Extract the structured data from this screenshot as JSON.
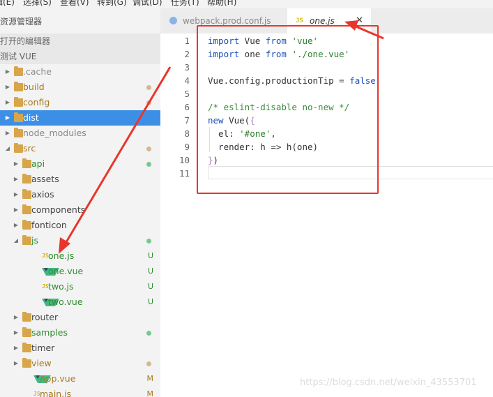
{
  "menu": [
    "辑(E)",
    "选择(S)",
    "查看(V)",
    "转到(G)",
    "调试(D)",
    "任务(T)",
    "帮助(H)"
  ],
  "sidebar": {
    "title": "资源管理器",
    "open_editors": "打开的编辑器",
    "project": "测试 VUE",
    "items": [
      {
        "label": ".cache",
        "type": "folder",
        "depth": 0,
        "expanded": false,
        "status": "",
        "label_color": "#8a8a8a"
      },
      {
        "label": "build",
        "type": "folder",
        "depth": 0,
        "expanded": false,
        "status": "dot",
        "status_color": "#d4b98c",
        "label_color": "#a67a1f"
      },
      {
        "label": "config",
        "type": "folder",
        "depth": 0,
        "expanded": false,
        "status": "dot",
        "status_color": "#d4b98c",
        "label_color": "#a67a1f"
      },
      {
        "label": "dist",
        "type": "folder",
        "depth": 0,
        "expanded": false,
        "status": "",
        "label_color": "#ffffff",
        "selected": true
      },
      {
        "label": "node_modules",
        "type": "folder",
        "depth": 0,
        "expanded": false,
        "status": "",
        "label_color": "#8a8a8a"
      },
      {
        "label": "src",
        "type": "folder",
        "depth": 0,
        "expanded": true,
        "status": "dot",
        "status_color": "#d4b98c",
        "label_color": "#a67a1f"
      },
      {
        "label": "api",
        "type": "folder",
        "depth": 1,
        "expanded": false,
        "status": "dot",
        "status_color": "#73c991",
        "label_color": "#2e8b2e"
      },
      {
        "label": "assets",
        "type": "folder",
        "depth": 1,
        "expanded": false,
        "status": "",
        "label_color": "#444444"
      },
      {
        "label": "axios",
        "type": "folder",
        "depth": 1,
        "expanded": false,
        "status": "",
        "label_color": "#444444"
      },
      {
        "label": "components",
        "type": "folder",
        "depth": 1,
        "expanded": false,
        "status": "",
        "label_color": "#444444"
      },
      {
        "label": "fonticon",
        "type": "folder",
        "depth": 1,
        "expanded": false,
        "status": "",
        "label_color": "#444444"
      },
      {
        "label": "js",
        "type": "folder",
        "depth": 1,
        "expanded": true,
        "status": "dot",
        "status_color": "#73c991",
        "label_color": "#2e8b2e"
      },
      {
        "label": "one.js",
        "type": "js",
        "depth": 2,
        "status": "U",
        "status_color": "#2e8b2e",
        "label_color": "#2e8b2e"
      },
      {
        "label": "one.vue",
        "type": "vue",
        "depth": 2,
        "status": "U",
        "status_color": "#2e8b2e",
        "label_color": "#2e8b2e"
      },
      {
        "label": "two.js",
        "type": "js",
        "depth": 2,
        "status": "U",
        "status_color": "#2e8b2e",
        "label_color": "#2e8b2e"
      },
      {
        "label": "two.vue",
        "type": "vue",
        "depth": 2,
        "status": "U",
        "status_color": "#2e8b2e",
        "label_color": "#2e8b2e"
      },
      {
        "label": "router",
        "type": "folder",
        "depth": 1,
        "expanded": false,
        "status": "",
        "label_color": "#444444"
      },
      {
        "label": "samples",
        "type": "folder",
        "depth": 1,
        "expanded": false,
        "status": "dot",
        "status_color": "#73c991",
        "label_color": "#2e8b2e"
      },
      {
        "label": "timer",
        "type": "folder",
        "depth": 1,
        "expanded": false,
        "status": "",
        "label_color": "#444444"
      },
      {
        "label": "view",
        "type": "folder",
        "depth": 1,
        "expanded": false,
        "status": "dot",
        "status_color": "#d4b98c",
        "label_color": "#a67a1f"
      },
      {
        "label": "App.vue",
        "type": "vue",
        "depth": 1,
        "status": "M",
        "status_color": "#a67a1f",
        "label_color": "#a67a1f"
      },
      {
        "label": "main.js",
        "type": "js",
        "depth": 1,
        "status": "M",
        "status_color": "#a67a1f",
        "label_color": "#a67a1f"
      }
    ]
  },
  "tabs": [
    {
      "label": "webpack.prod.conf.js",
      "active": false
    },
    {
      "label": "one.js",
      "active": true,
      "icon_text": "JS",
      "close": "✕"
    }
  ],
  "editor": {
    "lines": [
      [
        {
          "t": "import",
          "c": "kw"
        },
        {
          "t": " Vue ",
          "c": ""
        },
        {
          "t": "from",
          "c": "kw"
        },
        {
          "t": " ",
          "c": ""
        },
        {
          "t": "'vue'",
          "c": "str"
        }
      ],
      [
        {
          "t": "import",
          "c": "kw"
        },
        {
          "t": " one ",
          "c": ""
        },
        {
          "t": "from",
          "c": "kw"
        },
        {
          "t": " ",
          "c": ""
        },
        {
          "t": "'./one.vue'",
          "c": "str"
        }
      ],
      [],
      [
        {
          "t": "Vue.config.productionTip = ",
          "c": ""
        },
        {
          "t": "false",
          "c": "kw"
        }
      ],
      [],
      [
        {
          "t": "/* eslint-disable no-new */",
          "c": "cm"
        }
      ],
      [
        {
          "t": "new",
          "c": "kw"
        },
        {
          "t": " Vue(",
          "c": ""
        },
        {
          "t": "{",
          "c": "br"
        }
      ],
      [
        {
          "t": "  el: ",
          "c": ""
        },
        {
          "t": "'#one'",
          "c": "str"
        },
        {
          "t": ",",
          "c": ""
        }
      ],
      [
        {
          "t": "  render: h => h(one)",
          "c": ""
        }
      ],
      [
        {
          "t": "}",
          "c": "br"
        },
        {
          "t": ")",
          "c": ""
        }
      ],
      []
    ]
  },
  "watermark": "https://blog.csdn.net/weixin_43553701"
}
